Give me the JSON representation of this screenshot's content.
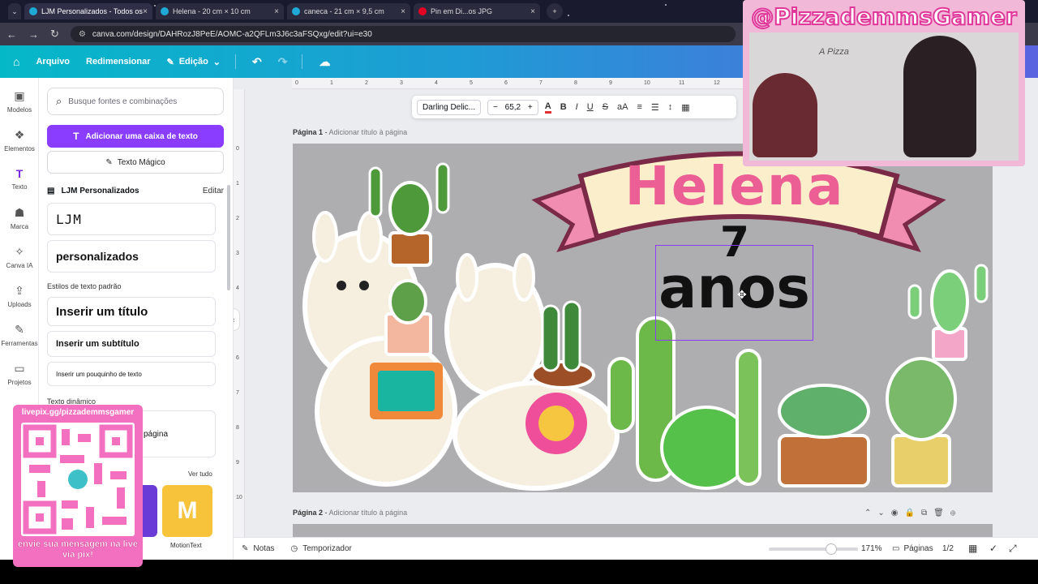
{
  "browser": {
    "tabs": [
      {
        "label": "LJM Personalizados - Todos os",
        "favicon_color": "#1fa9d6",
        "active": true
      },
      {
        "label": "Helena - 20 cm × 10 cm",
        "favicon_color": "#1fa9d6",
        "active": false
      },
      {
        "label": "caneca - 21 cm × 9,5 cm",
        "favicon_color": "#1fa9d6",
        "active": false
      },
      {
        "label": "Pin em Di...os JPG",
        "favicon_color": "#e60023",
        "active": false
      }
    ],
    "url": "canva.com/design/DAHRozJ8PeE/AOMC-a2QFLm3J6c3aFSQxg/edit?ui=e30"
  },
  "header": {
    "file_label": "Arquivo",
    "resize_label": "Redimensionar",
    "edit_label": "Edição"
  },
  "rail": [
    {
      "label": "Modelos",
      "icon": "templates-icon",
      "glyph": "▣"
    },
    {
      "label": "Elementos",
      "icon": "elements-icon",
      "glyph": "❖"
    },
    {
      "label": "Texto",
      "icon": "text-icon",
      "glyph": "T"
    },
    {
      "label": "Marca",
      "icon": "brand-icon",
      "glyph": "☗"
    },
    {
      "label": "Canva IA",
      "icon": "canva-ai-icon",
      "glyph": "✧"
    },
    {
      "label": "Uploads",
      "icon": "upload-icon",
      "glyph": "⇪"
    },
    {
      "label": "Ferramentas",
      "icon": "tools-icon",
      "glyph": "✎"
    },
    {
      "label": "Projetos",
      "icon": "folder-icon",
      "glyph": "▭"
    }
  ],
  "panel": {
    "search_placeholder": "Busque fontes e combinações",
    "add_text_label": "Adicionar uma caixa de texto",
    "magic_text_label": "Texto Mágico",
    "brand_kit_label": "LJM Personalizados",
    "brand_edit_label": "Editar",
    "brand_styles": [
      "LJM",
      "personalizados"
    ],
    "default_styles_title": "Estilos de texto padrão",
    "heading_label": "Inserir um título",
    "subheading_label": "Inserir um subtítulo",
    "body_label": "Inserir um pouquinho de texto",
    "dynamic_title": "Texto dinâmico",
    "dynamic_item": "página",
    "see_all": "Ver tudo",
    "motion_label": "MotionText"
  },
  "toolbar": {
    "font": "Darling Delic...",
    "size": "65,2",
    "buttons": [
      "B",
      "I",
      "U",
      "S",
      "aA"
    ]
  },
  "ruler_top": [
    "0",
    "1",
    "2",
    "3",
    "4",
    "5",
    "6",
    "7",
    "8",
    "9",
    "10",
    "11",
    "12"
  ],
  "ruler_left": [
    "0",
    "1",
    "2",
    "3",
    "4",
    "5",
    "6",
    "7",
    "8",
    "9",
    "10"
  ],
  "pages": [
    {
      "label": "Página 1",
      "subtitle": "Adicionar título à página"
    },
    {
      "label": "Página 2",
      "subtitle": "Adicionar título à página"
    }
  ],
  "design": {
    "name": "Helena",
    "number": "7",
    "years": "anos",
    "name_color": "#ec5f94",
    "banner_color": "#faeecb",
    "banner_outline": "#7a2946"
  },
  "bottom": {
    "notes_label": "Notas",
    "timer_label": "Temporizador",
    "zoom": "171%",
    "pages_label": "Páginas",
    "page_count": "1/2"
  },
  "overlay": {
    "channel": "@PizzademmsGamer",
    "qr_url": "livepix.gg/pizzademmsgamer",
    "qr_message": "envie sua mensagem na live via pix!"
  }
}
